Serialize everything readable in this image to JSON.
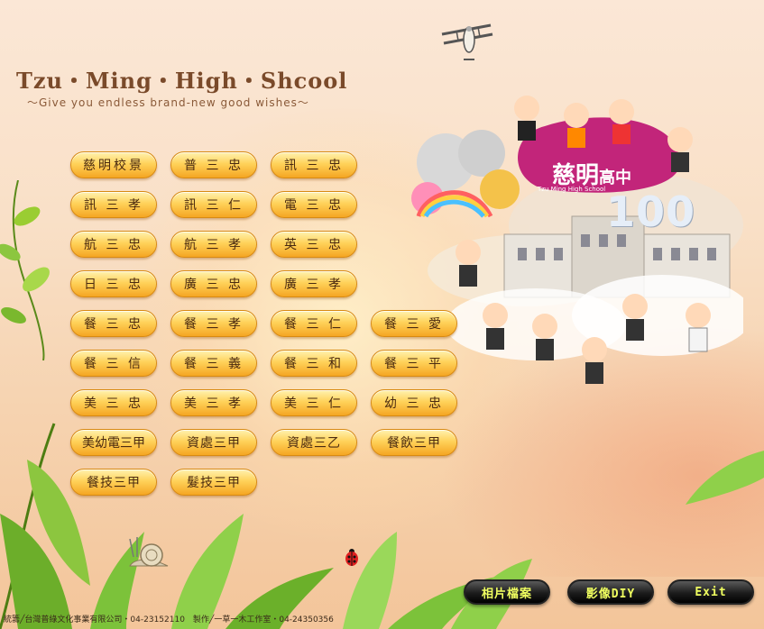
{
  "header": {
    "title": "Tzu・Ming・High・Shcool",
    "subtitle": "～Give you endless brand-new good wishes～"
  },
  "classes": [
    "慈明校景",
    "普 三 忠",
    "訊 三 忠",
    "訊 三 孝",
    "訊 三 仁",
    "電 三 忠",
    "航 三 忠",
    "航 三 孝",
    "英 三 忠",
    "日 三 忠",
    "廣 三 忠",
    "廣 三 孝",
    "餐 三 忠",
    "餐 三 孝",
    "餐 三 仁",
    "餐 三 愛",
    "餐 三 信",
    "餐 三 義",
    "餐 三 和",
    "餐 三 平",
    "美 三 忠",
    "美 三 孝",
    "美 三 仁",
    "幼 三 忠",
    "美幼電三甲",
    "資處三甲",
    "資處三乙",
    "餐飲三甲",
    "餐技三甲",
    "髮技三甲"
  ],
  "logo": {
    "name": "慈明",
    "name_suffix": "高中",
    "english": "Tzu Ming High School",
    "number": "100"
  },
  "bottom_buttons": {
    "photos": "相片檔案",
    "video_diy": "影像DIY",
    "exit": "Exit"
  },
  "footer": "統籌╱台灣普綠文化事業有限公司・04-23152110　製作╱一草一木工作室・04-24350356",
  "icons": [
    "biplane-icon",
    "ladybug-icon",
    "snail-icon",
    "leaf-icon"
  ],
  "colors": {
    "button_gold": "#ffd25a",
    "button_border": "#d88a12",
    "bottom_button_text": "#f0ff60",
    "title": "#7a4a2a"
  }
}
